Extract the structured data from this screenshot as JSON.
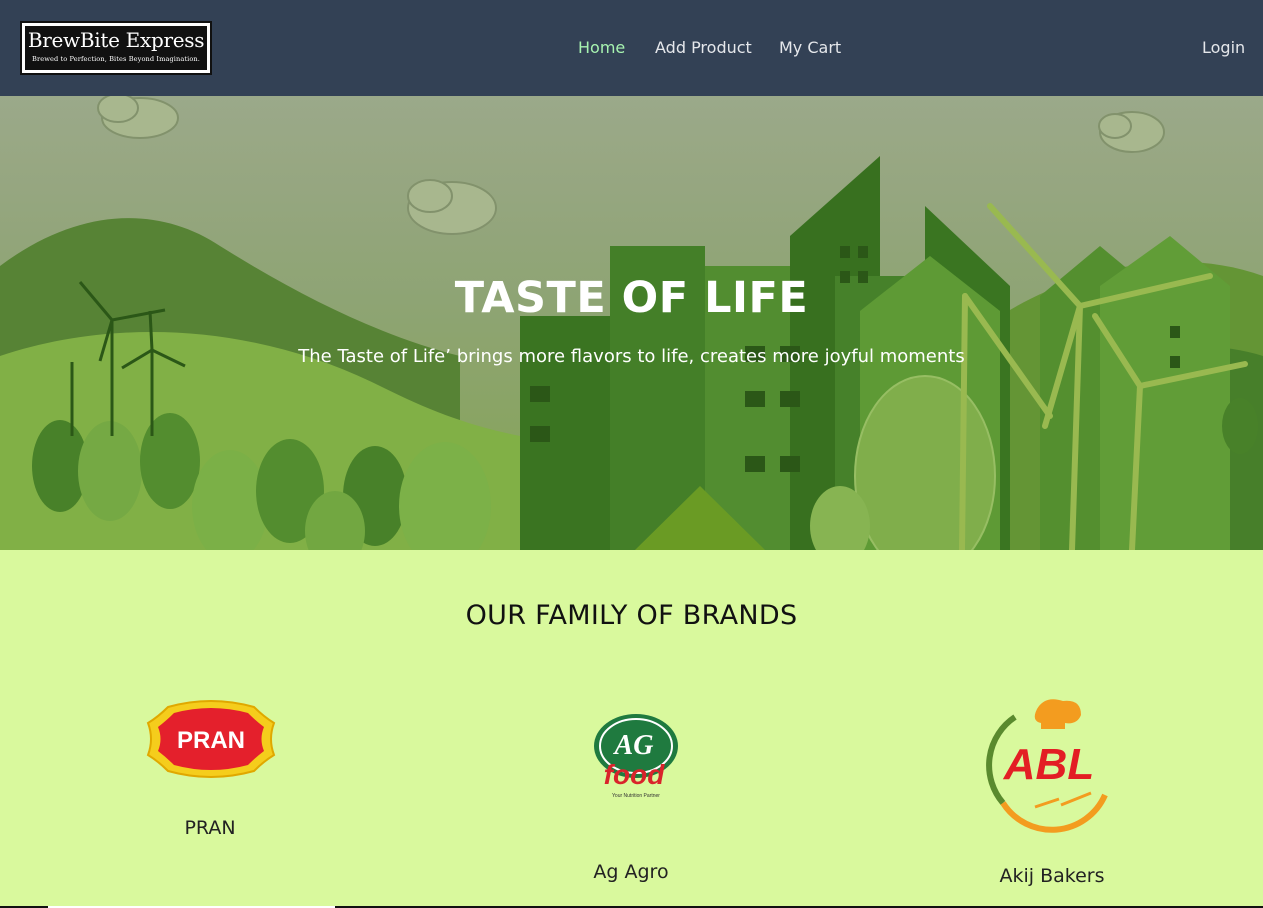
{
  "nav": {
    "brand_title": "BrewBite Express",
    "brand_tagline": "Brewed to Perfection, Bites Beyond Imagination.",
    "links": [
      {
        "label": "Home",
        "active": true
      },
      {
        "label": "Add Product",
        "active": false
      },
      {
        "label": "My Cart",
        "active": false
      }
    ],
    "login_label": "Login"
  },
  "hero": {
    "title": "TASTE OF LIFE",
    "subtitle": "The Taste of Life’ brings more flavors to life, creates more joyful moments"
  },
  "brands": {
    "heading": "OUR FAMILY OF BRANDS",
    "items": [
      {
        "name": "PRAN",
        "logo_text": "PRAN"
      },
      {
        "name": "Ag Agro",
        "logo_text": "AG",
        "logo_text2": "food",
        "logo_tagline": "Your Nutrition Partner"
      },
      {
        "name": "Akij Bakers",
        "logo_text": "ABL"
      }
    ]
  },
  "colors": {
    "navbar_bg": "#334155",
    "nav_active": "#a7f3b0",
    "page_bg": "#d9f99d",
    "hero_green": "#4c8a2a"
  }
}
